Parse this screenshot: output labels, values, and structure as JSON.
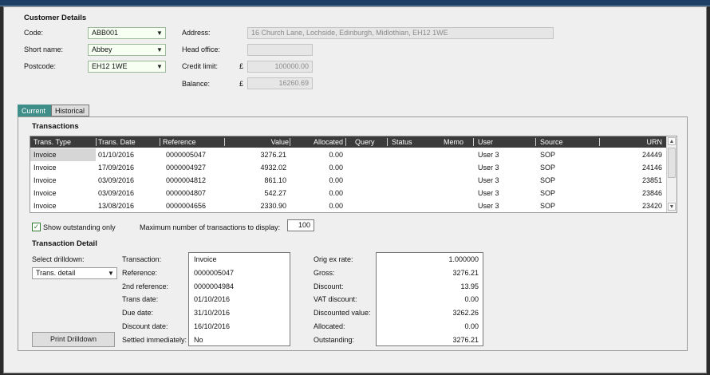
{
  "customer": {
    "section_title": "Customer Details",
    "code_label": "Code:",
    "code_value": "ABB001",
    "short_name_label": "Short name:",
    "short_name_value": "Abbey",
    "postcode_label": "Postcode:",
    "postcode_value": "EH12 1WE",
    "address_label": "Address:",
    "address_value": "16 Church Lane, Lochside, Edinburgh, Midlothian, EH12 1WE",
    "head_office_label": "Head office:",
    "head_office_value": "",
    "credit_limit_label": "Credit limit:",
    "credit_limit_currency": "£",
    "credit_limit_value": "100000.00",
    "balance_label": "Balance:",
    "balance_currency": "£",
    "balance_value": "16260.69"
  },
  "tabs": [
    {
      "label": "Current",
      "active": true
    },
    {
      "label": "Historical",
      "active": false
    }
  ],
  "transactions": {
    "section_title": "Transactions",
    "columns": [
      "Trans. Type",
      "Trans. Date",
      "Reference",
      "Value",
      "Allocated",
      "Query",
      "Status",
      "Memo",
      "User",
      "Source",
      "URN"
    ],
    "rows": [
      [
        "Invoice",
        "01/10/2016",
        "0000005047",
        "3276.21",
        "0.00",
        "",
        "",
        "",
        "User 3",
        "SOP",
        "24449"
      ],
      [
        "Invoice",
        "17/09/2016",
        "0000004927",
        "4932.02",
        "0.00",
        "",
        "",
        "",
        "User 3",
        "SOP",
        "24146"
      ],
      [
        "Invoice",
        "03/09/2016",
        "0000004812",
        "861.10",
        "0.00",
        "",
        "",
        "",
        "User 3",
        "SOP",
        "23851"
      ],
      [
        "Invoice",
        "03/09/2016",
        "0000004807",
        "542.27",
        "0.00",
        "",
        "",
        "",
        "User 3",
        "SOP",
        "23846"
      ],
      [
        "Invoice",
        "13/08/2016",
        "0000004656",
        "2330.90",
        "0.00",
        "",
        "",
        "",
        "User 3",
        "SOP",
        "23420"
      ]
    ],
    "show_outstanding_label": "Show outstanding only",
    "show_outstanding_checked": true,
    "max_label": "Maximum number of transactions to display:",
    "max_value": "100"
  },
  "detail": {
    "section_title": "Transaction Detail",
    "select_drilldown_label": "Select drilldown:",
    "drilldown_value": "Trans. detail",
    "print_button": "Print Drilldown",
    "left": [
      {
        "label": "Transaction:",
        "value": "Invoice"
      },
      {
        "label": "Reference:",
        "value": "0000005047"
      },
      {
        "label": "2nd reference:",
        "value": "0000004984"
      },
      {
        "label": "Trans date:",
        "value": "01/10/2016"
      },
      {
        "label": "Due date:",
        "value": "31/10/2016"
      },
      {
        "label": "Discount date:",
        "value": "16/10/2016"
      },
      {
        "label": "Settled immediately:",
        "value": "No"
      }
    ],
    "right": [
      {
        "label": "Orig ex rate:",
        "value": "1.000000"
      },
      {
        "label": "Gross:",
        "value": "3276.21"
      },
      {
        "label": "Discount:",
        "value": "13.95"
      },
      {
        "label": "VAT discount:",
        "value": "0.00"
      },
      {
        "label": "Discounted value:",
        "value": "3262.26"
      },
      {
        "label": "Allocated:",
        "value": "0.00"
      },
      {
        "label": "Outstanding:",
        "value": "3276.21"
      }
    ]
  },
  "icons": {
    "dropdown": "chevron-down-icon",
    "check": "checkmark-icon",
    "scroll_up": "scroll-up-icon",
    "scroll_down": "scroll-down-icon"
  },
  "colors": {
    "tab_active": "#3f8e8a",
    "grid_header": "#3b3b3b",
    "combo_bg": "#f7fff2",
    "title_bar": "#1d3f66"
  }
}
